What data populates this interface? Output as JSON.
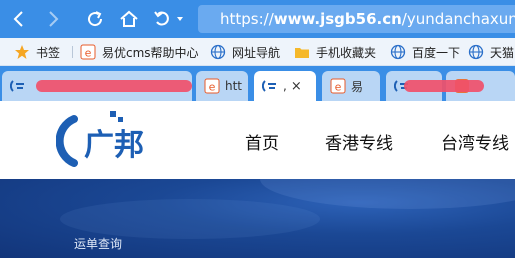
{
  "toolbar": {
    "url_prefix": "https://",
    "url_domain": "www.jsgb56.cn",
    "url_path": "/yundanchaxun/"
  },
  "bookmarks": {
    "items": [
      {
        "label": "书签",
        "icon": "star-icon"
      },
      {
        "label": "易优cms帮助中心",
        "icon": "eyou-icon"
      },
      {
        "label": "网址导航",
        "icon": "globe-icon"
      },
      {
        "label": "手机收藏夹",
        "icon": "folder-icon"
      },
      {
        "label": "百度一下",
        "icon": "globe-icon"
      },
      {
        "label": "天猫",
        "icon": "globe-icon"
      }
    ]
  },
  "tabs": [
    {
      "label": "",
      "icon": "guangbang-favicon"
    },
    {
      "label": "htt",
      "icon": "eyou-icon"
    },
    {
      "label": ",",
      "icon": "guangbang-favicon",
      "active": true,
      "close": "×"
    },
    {
      "label": "易",
      "icon": "eyou-icon"
    },
    {
      "label": "",
      "icon": "guangbang-favicon"
    },
    {
      "label": "",
      "icon": "orange-favicon"
    }
  ],
  "site": {
    "logo_text": "广邦",
    "nav": [
      "首页",
      "香港专线",
      "台湾专线"
    ]
  },
  "banner": {
    "label": "运单查询"
  },
  "colors": {
    "chrome_blue": "#3a8ee6",
    "redaction": "#f0506a",
    "logo_blue": "#1d5fb4"
  }
}
